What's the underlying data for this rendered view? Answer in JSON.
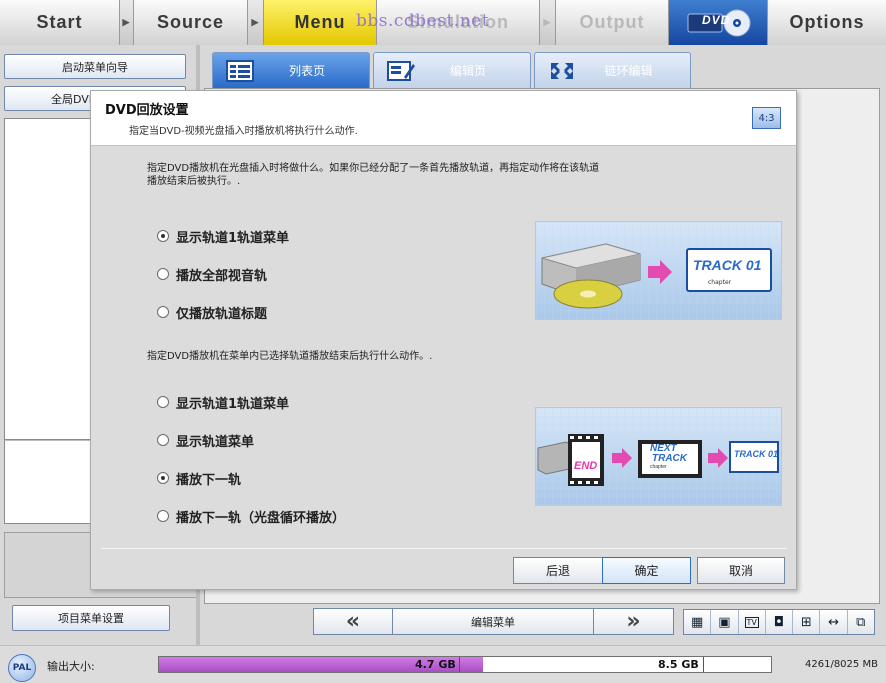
{
  "topbar": {
    "start": "Start",
    "source": "Source",
    "menu": "Menu",
    "simulation": "Simulation",
    "output": "Output",
    "dvd": "DVD",
    "options": "Options",
    "arrow": "▶",
    "watermark": "bbs.cdbest.net"
  },
  "left": {
    "wizard_button": "启动菜单向导",
    "global_button": "全局DVD",
    "project_menu_button": "项目菜单设置"
  },
  "tabs": [
    {
      "label": "列表页"
    },
    {
      "label": "编辑页"
    },
    {
      "label": "链环编辑"
    }
  ],
  "dialog": {
    "title": "DVD回放设置",
    "subtitle": "指定当DVD-视频光盘插入时播放机将执行什么动作.",
    "aspect_ratio": "4:3",
    "section1_desc_line1": "指定DVD播放机在光盘插入时将做什么。如果你已经分配了一条首先播放轨道，再指定动作将在该轨道",
    "section1_desc_line2": "播放结束后被执行。.",
    "section1_options": [
      {
        "label": "显示轨道1轨道菜单",
        "selected": true
      },
      {
        "label": "播放全部视音轨",
        "selected": false
      },
      {
        "label": "仅播放轨道标题",
        "selected": false
      }
    ],
    "illus1": {
      "track_label": "TRACK 01",
      "chapter_label": "chapter"
    },
    "section2_desc": "指定DVD播放机在菜单内已选择轨道播放结束后执行什么动作。.",
    "section2_options": [
      {
        "label": "显示轨道1轨道菜单",
        "selected": false
      },
      {
        "label": "显示轨道菜单",
        "selected": false
      },
      {
        "label": "播放下一轨",
        "selected": true
      },
      {
        "label": "播放下一轨（光盘循环播放）",
        "selected": false
      }
    ],
    "illus2": {
      "end_label": "END",
      "next_label_line1": "NEXT",
      "next_label_line2": "TRACK",
      "chapter_label": "chapter",
      "track_label": "TRACK 01"
    },
    "buttons": {
      "back": "后退",
      "ok": "确定",
      "cancel": "取消"
    }
  },
  "bottom": {
    "prev": "«",
    "edit_menu": "编辑菜单",
    "next": "»",
    "view_icons": [
      "▦",
      "▣",
      "TV",
      "◘",
      "⊞",
      "↔",
      "⧉"
    ]
  },
  "status": {
    "pal": "PAL",
    "output_size_label": "输出大小:",
    "used_label": "4.7 GB",
    "capacity_label": "8.5 GB",
    "usage_text": "4261/8025 MB",
    "used_fraction": 0.53
  }
}
